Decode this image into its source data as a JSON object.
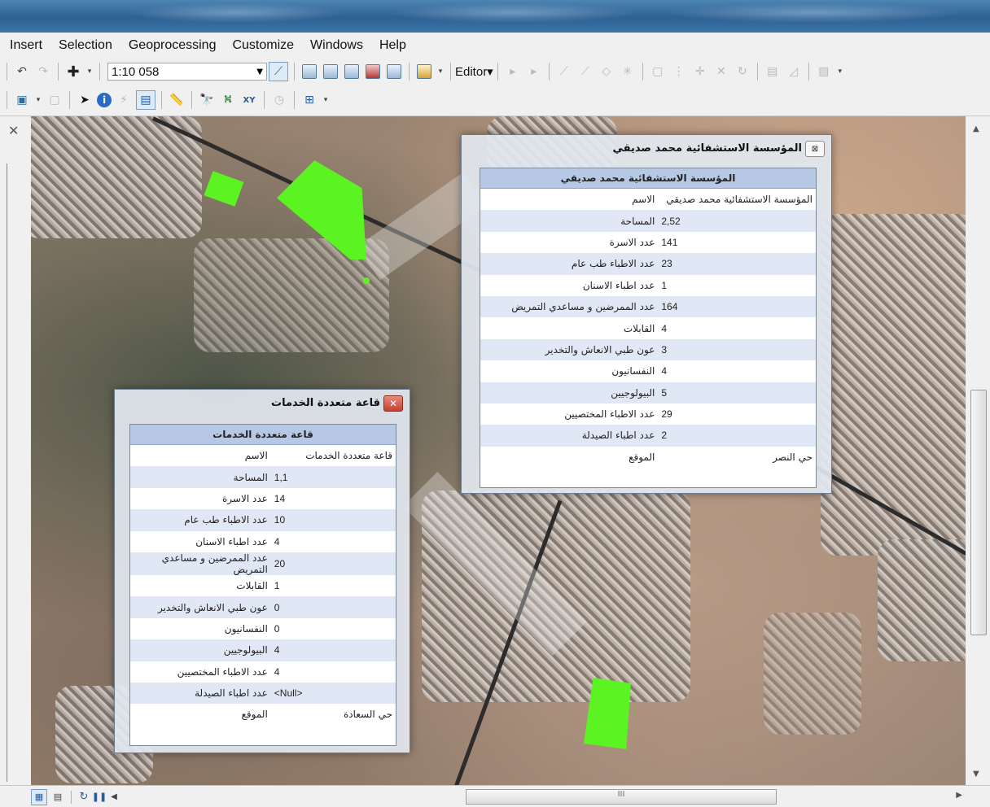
{
  "menu": [
    "Insert",
    "Selection",
    "Geoprocessing",
    "Customize",
    "Windows",
    "Help"
  ],
  "toolbar1": {
    "scale": "1:10 058",
    "editor": "Editor▾"
  },
  "colors": {
    "highlight": "#5bf321",
    "popup_header": "#b6c8e4",
    "row_alt": "#e1e8f5"
  },
  "icons": [
    "undo-icon",
    "redo-icon",
    "add-data-icon",
    "select-features-icon",
    "identify-icon",
    "find-icon",
    "measure-icon",
    "go-to-xy-icon",
    "html-popup-icon",
    "editor-tools-icon"
  ],
  "popup_left": {
    "title": "قاعة متعددة الخدمات",
    "header": "قاعة متعددة الخدمات",
    "rows": [
      {
        "field": "الاسم",
        "value": "قاعة متعددة الخدمات"
      },
      {
        "field": "المساحة",
        "value": "1,1"
      },
      {
        "field": "عدد الاسرة",
        "value": "14"
      },
      {
        "field": "عدد الاطباء طب عام",
        "value": "10"
      },
      {
        "field": "عدد اطباء الاسنان",
        "value": "4"
      },
      {
        "field": "عدد الممرضين و مساعدي التمريض",
        "value": "20"
      },
      {
        "field": "القابلات",
        "value": "1"
      },
      {
        "field": "عون طبي الانعاش والتخدير",
        "value": "0"
      },
      {
        "field": "النفسانيون",
        "value": "0"
      },
      {
        "field": "البيولوجيين",
        "value": "4"
      },
      {
        "field": "عدد الاطباء المختصيين",
        "value": "4"
      },
      {
        "field": "عدد اطباء الصيدلة",
        "value": "<Null>"
      },
      {
        "field": "الموقع",
        "value": "حي السعادة"
      }
    ]
  },
  "popup_right": {
    "title": "المؤسسة الاستشفائية محمد صديقي",
    "header": "المؤسسة الاستشفائية محمد صديقي",
    "rows": [
      {
        "field": "الاسم",
        "value": "المؤسسة الاستشفائية محمد صديقي"
      },
      {
        "field": "المساحة",
        "value": "2,52"
      },
      {
        "field": "عدد الاسرة",
        "value": "141"
      },
      {
        "field": "عدد الاطباء طب عام",
        "value": "23"
      },
      {
        "field": "عدد اطباء الاسنان",
        "value": "1"
      },
      {
        "field": "عدد الممرضين و مساعدي التمريض",
        "value": "164"
      },
      {
        "field": "القابلات",
        "value": "4"
      },
      {
        "field": "عون طبي الانعاش والتخدير",
        "value": "3"
      },
      {
        "field": "النفسانيون",
        "value": "4"
      },
      {
        "field": "البيولوجيين",
        "value": "5"
      },
      {
        "field": "عدد الاطباء المختصيين",
        "value": "29"
      },
      {
        "field": "عدد اطباء الصيدلة",
        "value": "2"
      },
      {
        "field": "الموقع",
        "value": "حي النصر"
      }
    ]
  },
  "scrollbar": {
    "h_thumb_label": "III"
  }
}
